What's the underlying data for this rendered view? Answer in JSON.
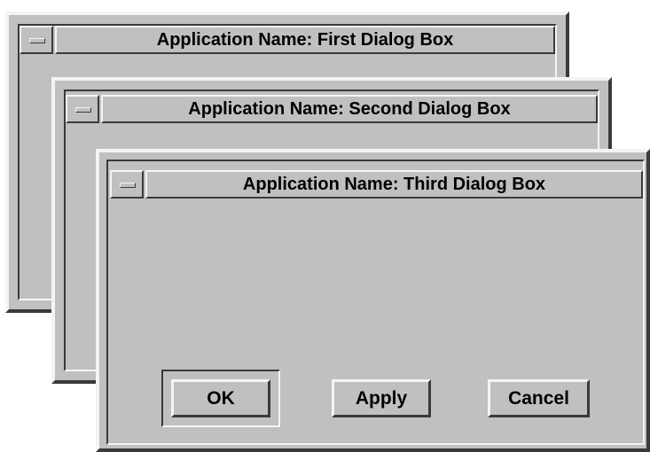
{
  "dialogs": [
    {
      "title": "Application Name: First Dialog Box"
    },
    {
      "title": "Application Name: Second Dialog Box"
    },
    {
      "title": "Application Name: Third Dialog Box",
      "buttons": {
        "ok": "OK",
        "apply": "Apply",
        "cancel": "Cancel"
      }
    }
  ],
  "colors": {
    "face": "#c0c0c0",
    "highlight": "#f4f4f4",
    "shadow": "#3a3a3a"
  },
  "icons": {
    "window_menu": "window-menu-icon"
  }
}
